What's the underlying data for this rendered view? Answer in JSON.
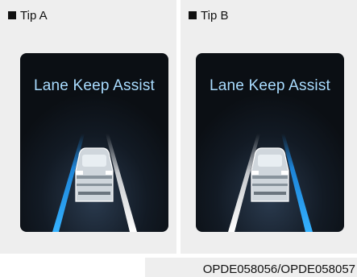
{
  "panels": [
    {
      "tip_label": "Tip A",
      "screen_title": "Lane Keep Assist",
      "highlighted_lane": "left",
      "accent_color": "#1e9bff"
    },
    {
      "tip_label": "Tip B",
      "screen_title": "Lane Keep Assist",
      "highlighted_lane": "right",
      "accent_color": "#1e9bff"
    }
  ],
  "caption": "OPDE058056/OPDE058057",
  "icons": [
    "square-bullet-icon",
    "car-rear-icon"
  ]
}
